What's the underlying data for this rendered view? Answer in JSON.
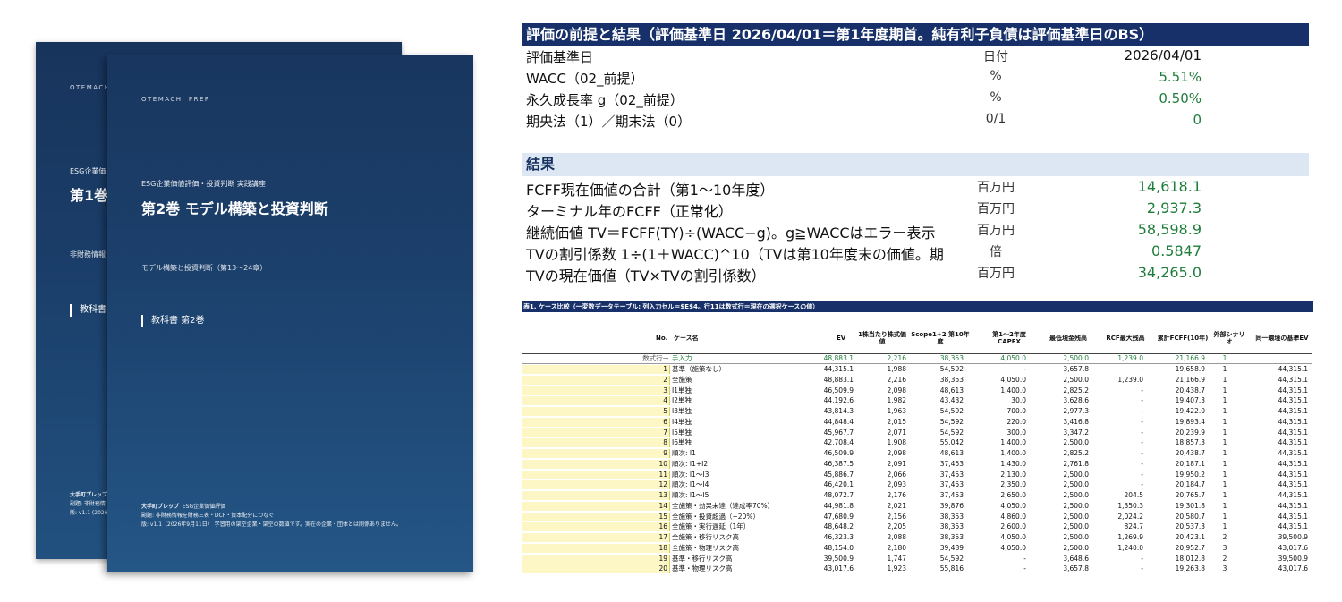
{
  "covers": {
    "back": {
      "brand": "OTEMACHI",
      "series": "ESG企業価",
      "title": "第1巻",
      "subtitle": "非財務情報",
      "tag": "教科書",
      "footer_publisher": "大手町プレップ",
      "footer_line2": "副題: 非財務情",
      "footer_line3": "版: v1.1 (2026"
    },
    "front": {
      "brand": "OTEMACHI PREP",
      "series": "ESG企業価値評価・投資判断 実践講座",
      "title": "第2巻 モデル構築と投資判断",
      "subtitle": "モデル構築と投資判断（第13〜24章）",
      "tag": "教科書 第2巻",
      "footer_publisher": "大手町プレップ",
      "footer_series": "ESG企業価値評価",
      "footer_line2": "副題: 非財務情報を財務三表・DCF・資本配分につなぐ",
      "footer_line3": "版: v1.1（2026年9月11日） 学習用の架空企業・架空の数値です。実在の企業・団体とは関係ありません。"
    }
  },
  "assumptions": {
    "header": "評価の前提と結果（評価基準日 2026/04/01＝第1年度期首。純有利子負債は評価基準日のBS）",
    "rows": [
      {
        "label": "評価基準日",
        "unit": "日付",
        "value": "2026/04/01"
      },
      {
        "label": "WACC（02_前提）",
        "unit": "%",
        "value": "5.51%"
      },
      {
        "label": "永久成長率 g（02_前提）",
        "unit": "%",
        "value": "0.50%"
      },
      {
        "label": "期央法（1）／期末法（0）",
        "unit": "0/1",
        "value": "0"
      }
    ]
  },
  "results": {
    "header": "結果",
    "rows": [
      {
        "label": "FCFF現在価値の合計（第1〜10年度）",
        "unit": "百万円",
        "value": "14,618.1"
      },
      {
        "label": "ターミナル年のFCFF（正常化）",
        "unit": "百万円",
        "value": "2,937.3"
      },
      {
        "label": "継続価値 TV＝FCFF(TY)÷(WACC−g)。g≧WACCはエラー表示",
        "unit": "百万円",
        "value": "58,598.9"
      },
      {
        "label": "TVの割引係数 1÷(1＋WACC)^10（TVは第10年度末の価値。期",
        "unit": "倍",
        "value": "0.5847"
      },
      {
        "label": "TVの現在価値（TV×TVの割引係数）",
        "unit": "百万円",
        "value": "34,265.0"
      }
    ]
  },
  "case_table": {
    "title": "表1. ケース比較（一変数データテーブル: 列入力セル＝$E$4。行11は数式行＝現在の選択ケースの値）",
    "headers": {
      "no": "No.",
      "name": "ケース名",
      "ev": "EV",
      "per_share_1": "1株当たり株式価",
      "per_share_2": "値",
      "scope_1": "Scope1+2 第10年",
      "scope_2": "度",
      "capex_1": "第1〜2年度",
      "capex_2": "CAPEX",
      "min_cash": "最低現金残高",
      "rcf_max": "RCF最大残高",
      "cum_fcff": "累計FCFF(10年)",
      "scenario_1": "外部シナリ",
      "scenario_2": "オ",
      "base_ev": "同一環境の基準EV"
    },
    "calc_row": {
      "no": "数式行→",
      "name": "手入力",
      "ev": "48,883.1",
      "ps": "2,216",
      "s12": "38,353",
      "cx": "4,050.0",
      "mc": "2,500.0",
      "rc": "1,239.0",
      "cum": "21,166.9",
      "sc": "1",
      "bev": ""
    },
    "rows": [
      {
        "no": "1",
        "name": "基準（施策なし）",
        "ev": "44,315.1",
        "ps": "1,988",
        "s12": "54,592",
        "cx": "-",
        "mc": "3,657.8",
        "rc": "-",
        "cum": "19,658.9",
        "sc": "1",
        "bev": "44,315.1"
      },
      {
        "no": "2",
        "name": "全施策",
        "ev": "48,883.1",
        "ps": "2,216",
        "s12": "38,353",
        "cx": "4,050.0",
        "mc": "2,500.0",
        "rc": "1,239.0",
        "cum": "21,166.9",
        "sc": "1",
        "bev": "44,315.1"
      },
      {
        "no": "3",
        "name": "I1単独",
        "ev": "46,509.9",
        "ps": "2,098",
        "s12": "48,613",
        "cx": "1,400.0",
        "mc": "2,825.2",
        "rc": "-",
        "cum": "20,438.7",
        "sc": "1",
        "bev": "44,315.1"
      },
      {
        "no": "4",
        "name": "I2単独",
        "ev": "44,192.6",
        "ps": "1,982",
        "s12": "43,432",
        "cx": "30.0",
        "mc": "3,628.6",
        "rc": "-",
        "cum": "19,407.3",
        "sc": "1",
        "bev": "44,315.1"
      },
      {
        "no": "5",
        "name": "I3単独",
        "ev": "43,814.3",
        "ps": "1,963",
        "s12": "54,592",
        "cx": "700.0",
        "mc": "2,977.3",
        "rc": "-",
        "cum": "19,422.0",
        "sc": "1",
        "bev": "44,315.1"
      },
      {
        "no": "6",
        "name": "I4単独",
        "ev": "44,848.4",
        "ps": "2,015",
        "s12": "54,592",
        "cx": "220.0",
        "mc": "3,416.8",
        "rc": "-",
        "cum": "19,893.4",
        "sc": "1",
        "bev": "44,315.1"
      },
      {
        "no": "7",
        "name": "I5単独",
        "ev": "45,967.7",
        "ps": "2,071",
        "s12": "54,592",
        "cx": "300.0",
        "mc": "3,347.2",
        "rc": "-",
        "cum": "20,239.9",
        "sc": "1",
        "bev": "44,315.1"
      },
      {
        "no": "8",
        "name": "I6単独",
        "ev": "42,708.4",
        "ps": "1,908",
        "s12": "55,042",
        "cx": "1,400.0",
        "mc": "2,500.0",
        "rc": "-",
        "cum": "18,857.3",
        "sc": "1",
        "bev": "44,315.1"
      },
      {
        "no": "9",
        "name": "順次: I1",
        "ev": "46,509.9",
        "ps": "2,098",
        "s12": "48,613",
        "cx": "1,400.0",
        "mc": "2,825.2",
        "rc": "-",
        "cum": "20,438.7",
        "sc": "1",
        "bev": "44,315.1"
      },
      {
        "no": "10",
        "name": "順次: I1+I2",
        "ev": "46,387.5",
        "ps": "2,091",
        "s12": "37,453",
        "cx": "1,430.0",
        "mc": "2,761.8",
        "rc": "-",
        "cum": "20,187.1",
        "sc": "1",
        "bev": "44,315.1"
      },
      {
        "no": "11",
        "name": "順次: I1〜I3",
        "ev": "45,886.7",
        "ps": "2,066",
        "s12": "37,453",
        "cx": "2,130.0",
        "mc": "2,500.0",
        "rc": "-",
        "cum": "19,950.2",
        "sc": "1",
        "bev": "44,315.1"
      },
      {
        "no": "12",
        "name": "順次: I1〜I4",
        "ev": "46,420.1",
        "ps": "2,093",
        "s12": "37,453",
        "cx": "2,350.0",
        "mc": "2,500.0",
        "rc": "-",
        "cum": "20,184.7",
        "sc": "1",
        "bev": "44,315.1"
      },
      {
        "no": "13",
        "name": "順次: I1〜I5",
        "ev": "48,072.7",
        "ps": "2,176",
        "s12": "37,453",
        "cx": "2,650.0",
        "mc": "2,500.0",
        "rc": "204.5",
        "cum": "20,765.7",
        "sc": "1",
        "bev": "44,315.1"
      },
      {
        "no": "14",
        "name": "全施策・効果未達（達成率70%）",
        "ev": "44,981.8",
        "ps": "2,021",
        "s12": "39,876",
        "cx": "4,050.0",
        "mc": "2,500.0",
        "rc": "1,350.3",
        "cum": "19,301.8",
        "sc": "1",
        "bev": "44,315.1"
      },
      {
        "no": "15",
        "name": "全施策・投資超過（+20%）",
        "ev": "47,680.9",
        "ps": "2,156",
        "s12": "38,353",
        "cx": "4,860.0",
        "mc": "2,500.0",
        "rc": "2,024.2",
        "cum": "20,580.7",
        "sc": "1",
        "bev": "44,315.1"
      },
      {
        "no": "16",
        "name": "全施策・実行遅延（1年）",
        "ev": "48,648.2",
        "ps": "2,205",
        "s12": "38,353",
        "cx": "2,600.0",
        "mc": "2,500.0",
        "rc": "824.7",
        "cum": "20,537.3",
        "sc": "1",
        "bev": "44,315.1"
      },
      {
        "no": "17",
        "name": "全施策・移行リスク高",
        "ev": "46,323.3",
        "ps": "2,088",
        "s12": "38,353",
        "cx": "4,050.0",
        "mc": "2,500.0",
        "rc": "1,269.9",
        "cum": "20,423.1",
        "sc": "2",
        "bev": "39,500.9"
      },
      {
        "no": "18",
        "name": "全施策・物理リスク高",
        "ev": "48,154.0",
        "ps": "2,180",
        "s12": "39,489",
        "cx": "4,050.0",
        "mc": "2,500.0",
        "rc": "1,240.0",
        "cum": "20,952.7",
        "sc": "3",
        "bev": "43,017.6"
      },
      {
        "no": "19",
        "name": "基準・移行リスク高",
        "ev": "39,500.9",
        "ps": "1,747",
        "s12": "54,592",
        "cx": "-",
        "mc": "3,648.6",
        "rc": "-",
        "cum": "18,012.8",
        "sc": "2",
        "bev": "39,500.9"
      },
      {
        "no": "20",
        "name": "基準・物理リスク高",
        "ev": "43,017.6",
        "ps": "1,923",
        "s12": "55,816",
        "cx": "-",
        "mc": "3,657.8",
        "rc": "-",
        "cum": "19,263.8",
        "sc": "3",
        "bev": "43,017.6"
      }
    ]
  },
  "colors": {
    "navy_header": "#17306a",
    "green_value": "#1e7d3a",
    "results_band": "#dde7f4",
    "input_cell": "#fdf7c5",
    "cover_blue": "#1c416d"
  }
}
